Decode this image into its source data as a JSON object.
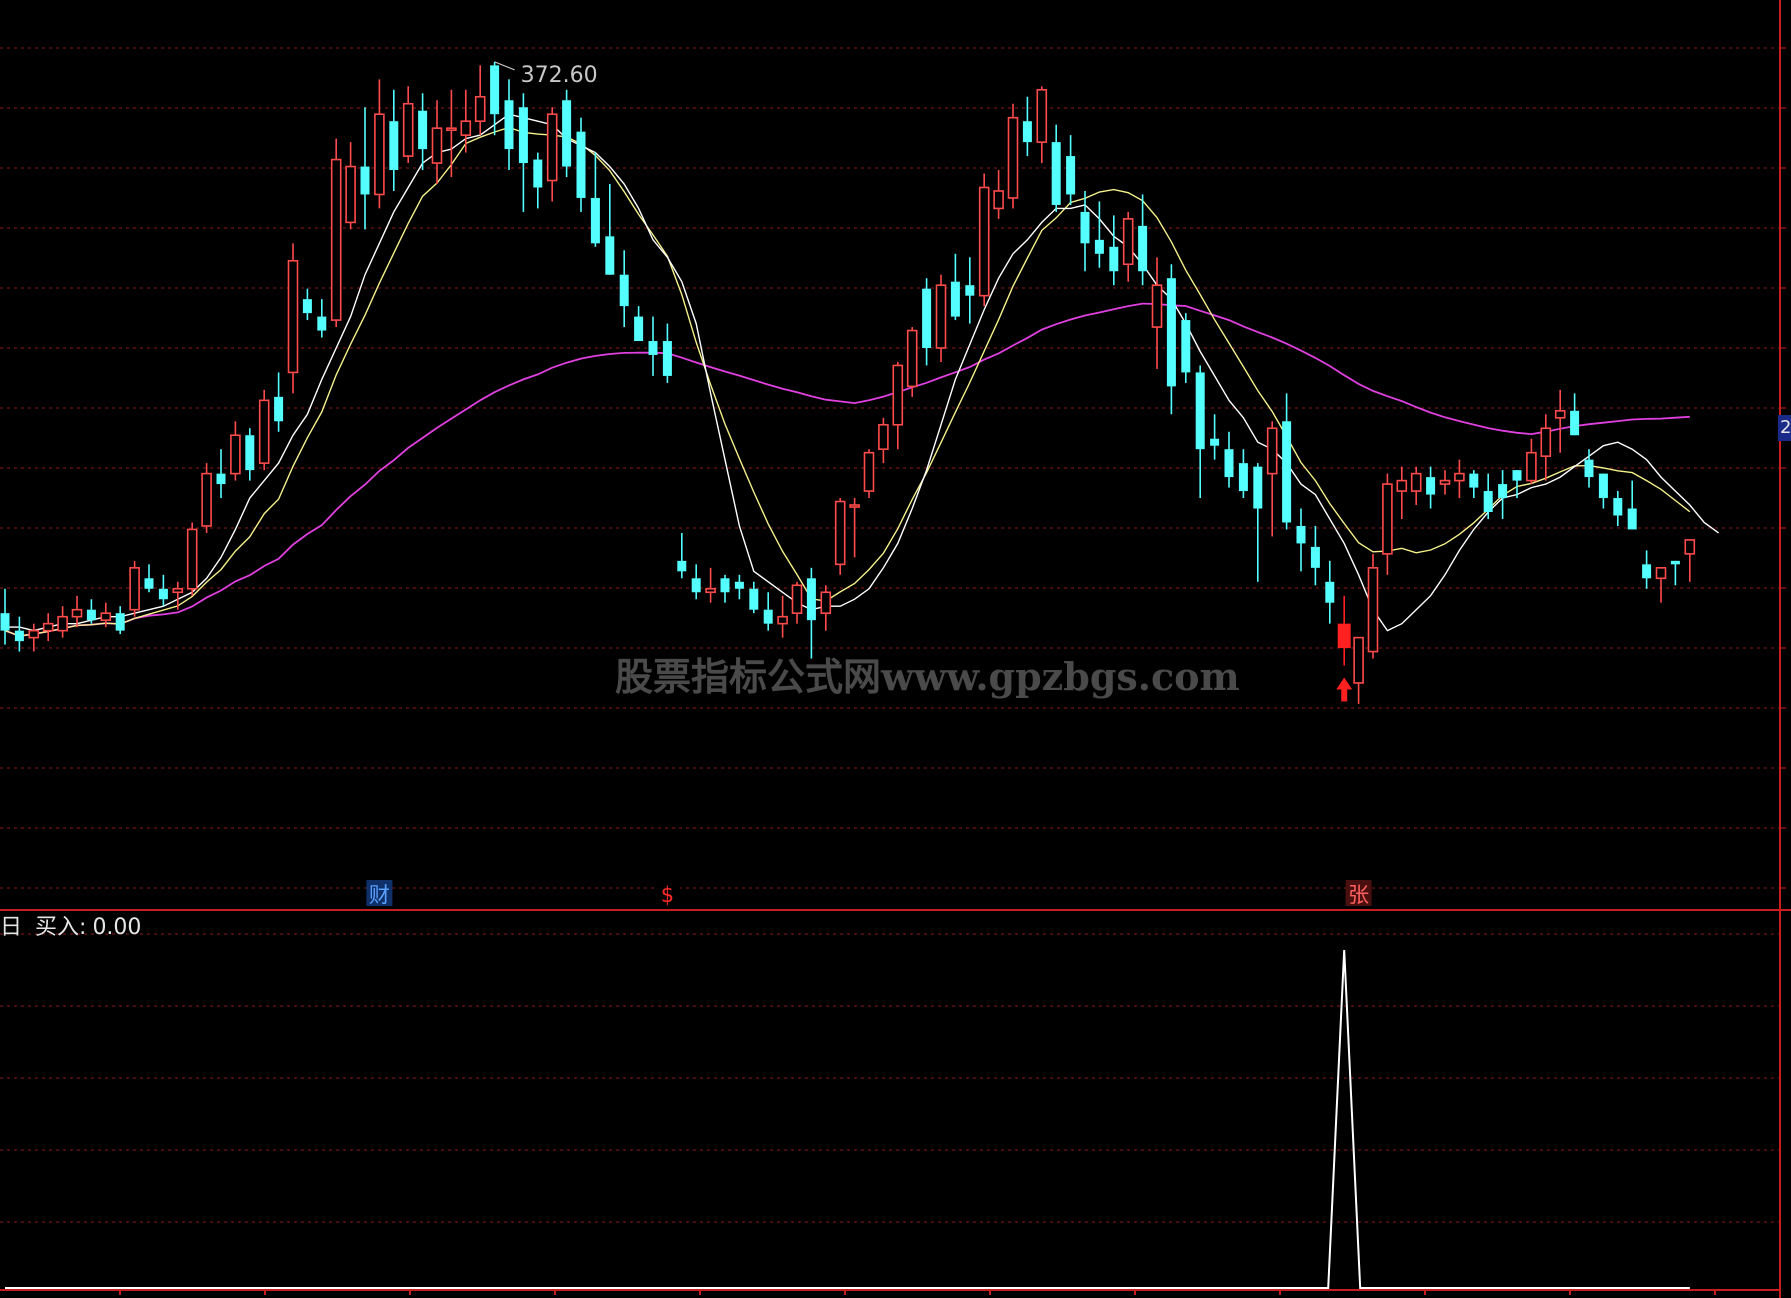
{
  "colors": {
    "background": "#000000",
    "grid": "#8a1a1a",
    "frame": "#c81e1e",
    "up_candle": "#ff4b4b",
    "down_candle": "#54ffff",
    "ma_fast": "#ffffff",
    "ma_mid": "#f5f08a",
    "ma_slow": "#e040e0",
    "signal_line": "#ffffff",
    "buy_candle": "#ff2020"
  },
  "top_legend_colors": [
    "#ff4b4b",
    "#54ff54",
    "#ff4b4b",
    "#ffff54",
    "#e6e6e6",
    "#ff4b4b",
    "#ff4bff",
    "#ffa050",
    "#e6e6e6",
    "#54ff54",
    "#ffa050"
  ],
  "price_peak_label": "372.60",
  "watermark": "股票指标公式网www.gpzbgs.com",
  "event_markers": [
    {
      "text": "财",
      "color": "#5aa0ff",
      "bg": "#10306a",
      "index": 26
    },
    {
      "text": "$",
      "color": "#ff2a2a",
      "bg": "#000000",
      "index": 46
    },
    {
      "text": "张",
      "color": "#ff6060",
      "bg": "#4a1010",
      "index": 94
    }
  ],
  "indicator": {
    "name": "日",
    "label": "买入:",
    "value": "0.00"
  },
  "right_axis_tag": "2",
  "chart_data": {
    "type": "candlestick",
    "ylim": [
      150,
      385
    ],
    "signal_index": 93,
    "candles": [
      [
        215,
        222,
        206,
        210
      ],
      [
        210,
        214,
        204,
        207
      ],
      [
        208,
        212,
        204,
        210
      ],
      [
        210,
        215,
        207,
        212
      ],
      [
        210,
        217,
        208,
        214
      ],
      [
        214,
        220,
        211,
        216
      ],
      [
        216,
        219,
        212,
        213
      ],
      [
        213,
        218,
        211,
        215
      ],
      [
        215,
        217,
        209,
        210
      ],
      [
        216,
        230,
        214,
        228
      ],
      [
        225,
        229,
        221,
        222
      ],
      [
        222,
        226,
        217,
        219
      ],
      [
        221,
        224,
        216,
        222
      ],
      [
        222,
        241,
        220,
        239
      ],
      [
        240,
        258,
        238,
        255
      ],
      [
        255,
        262,
        248,
        252
      ],
      [
        255,
        270,
        253,
        266
      ],
      [
        266,
        268,
        253,
        256
      ],
      [
        258,
        279,
        256,
        276
      ],
      [
        277,
        284,
        267,
        270
      ],
      [
        284,
        321,
        278,
        316
      ],
      [
        305,
        308,
        299,
        301
      ],
      [
        300,
        305,
        294,
        296
      ],
      [
        299,
        351,
        297,
        345
      ],
      [
        327,
        350,
        325,
        343
      ],
      [
        343,
        360,
        325,
        335
      ],
      [
        335,
        368,
        331,
        358
      ],
      [
        356,
        365,
        336,
        342
      ],
      [
        346,
        366,
        344,
        361
      ],
      [
        359,
        364,
        342,
        348
      ],
      [
        344,
        362,
        338,
        354
      ],
      [
        354,
        365,
        340,
        354
      ],
      [
        352,
        365,
        347,
        356
      ],
      [
        356,
        372,
        352,
        363
      ],
      [
        372,
        373,
        352,
        358
      ],
      [
        362,
        368,
        342,
        348
      ],
      [
        360,
        364,
        330,
        344
      ],
      [
        345,
        347,
        331,
        337
      ],
      [
        339,
        360,
        333,
        358
      ],
      [
        362,
        365,
        340,
        343
      ],
      [
        353,
        357,
        330,
        334
      ],
      [
        334,
        347,
        320,
        321
      ],
      [
        323,
        338,
        312,
        312
      ],
      [
        312,
        319,
        297,
        303
      ],
      [
        300,
        303,
        294,
        293
      ],
      [
        293,
        300,
        283,
        289
      ],
      [
        293,
        298,
        281,
        283
      ],
      [
        230,
        238,
        225,
        227
      ],
      [
        225,
        229,
        219,
        221
      ],
      [
        221,
        228,
        218,
        222
      ],
      [
        225,
        226,
        218,
        221
      ],
      [
        224,
        226,
        219,
        222
      ],
      [
        222,
        224,
        215,
        216
      ],
      [
        216,
        221,
        210,
        212
      ],
      [
        212,
        220,
        208,
        214
      ],
      [
        215,
        224,
        212,
        223
      ],
      [
        225,
        228,
        202,
        213
      ],
      [
        215,
        223,
        210,
        221
      ],
      [
        229,
        248,
        226,
        247
      ],
      [
        246,
        248,
        231,
        246
      ],
      [
        250,
        262,
        248,
        261
      ],
      [
        262,
        271,
        258,
        269
      ],
      [
        269,
        287,
        262,
        286
      ],
      [
        280,
        297,
        277,
        296
      ],
      [
        308,
        311,
        286,
        291
      ],
      [
        291,
        312,
        287,
        309
      ],
      [
        310,
        318,
        299,
        300
      ],
      [
        309,
        317,
        298,
        306
      ],
      [
        306,
        341,
        303,
        337
      ],
      [
        331,
        342,
        328,
        336
      ],
      [
        334,
        361,
        331,
        357
      ],
      [
        356,
        363,
        346,
        350
      ],
      [
        350,
        366,
        344,
        365
      ],
      [
        350,
        355,
        330,
        332
      ],
      [
        346,
        352,
        332,
        335
      ],
      [
        330,
        336,
        313,
        321
      ],
      [
        322,
        333,
        314,
        318
      ],
      [
        320,
        329,
        309,
        313
      ],
      [
        315,
        330,
        310,
        328
      ],
      [
        326,
        335,
        309,
        313
      ],
      [
        297,
        317,
        285,
        309
      ],
      [
        311,
        315,
        272,
        280
      ],
      [
        299,
        301,
        281,
        284
      ],
      [
        284,
        286,
        248,
        262
      ],
      [
        265,
        272,
        259,
        263
      ],
      [
        262,
        267,
        251,
        254
      ],
      [
        258,
        262,
        248,
        250
      ],
      [
        257,
        258,
        224,
        245
      ],
      [
        255,
        270,
        237,
        268
      ],
      [
        270,
        278,
        239,
        241
      ],
      [
        240,
        245,
        227,
        235
      ],
      [
        234,
        240,
        223,
        228
      ],
      [
        224,
        230,
        212,
        218
      ],
      [
        212,
        220,
        200,
        205
      ],
      [
        195,
        206,
        189,
        208
      ],
      [
        204,
        232,
        202,
        228
      ],
      [
        232,
        255,
        226,
        252
      ],
      [
        250,
        257,
        242,
        253
      ],
      [
        250,
        257,
        246,
        255
      ],
      [
        254,
        257,
        245,
        249
      ],
      [
        252,
        256,
        249,
        253
      ],
      [
        253,
        259,
        248,
        255
      ],
      [
        255,
        256,
        248,
        251
      ],
      [
        250,
        255,
        242,
        244
      ],
      [
        252,
        256,
        242,
        248
      ],
      [
        256,
        256,
        248,
        253
      ],
      [
        253,
        265,
        252,
        261
      ],
      [
        260,
        272,
        253,
        268
      ],
      [
        271,
        279,
        261,
        273
      ],
      [
        273,
        278,
        266,
        266
      ],
      [
        259,
        262,
        251,
        254
      ],
      [
        255,
        255,
        245,
        248
      ],
      [
        248,
        250,
        240,
        243
      ],
      [
        245,
        253,
        239,
        239
      ],
      [
        229,
        233,
        222,
        225
      ],
      [
        225,
        228,
        218,
        228
      ],
      [
        230,
        230,
        223,
        229
      ],
      [
        232,
        234,
        224,
        236
      ]
    ],
    "ma_fast": [
      211,
      211,
      210,
      211,
      212,
      212,
      213,
      214,
      214,
      215,
      216,
      217,
      219,
      221,
      225,
      231,
      239,
      248,
      253,
      258,
      266,
      272,
      282,
      291,
      300,
      312,
      321,
      330,
      337,
      344,
      347,
      348,
      351,
      352,
      355,
      358,
      357,
      356,
      355,
      351,
      349,
      347,
      343,
      338,
      331,
      322,
      317,
      310,
      298,
      278,
      259,
      240,
      227,
      224,
      221,
      218,
      216,
      217,
      217,
      219,
      222,
      228,
      235,
      245,
      256,
      269,
      282,
      292,
      302,
      311,
      318,
      322,
      327,
      331,
      331,
      332,
      328,
      323,
      320,
      315,
      309,
      305,
      298,
      290,
      283,
      276,
      271,
      264,
      262,
      258,
      252,
      249,
      242,
      235,
      226,
      216,
      210,
      212,
      216,
      220,
      226,
      233,
      239,
      244,
      248,
      249,
      251,
      252,
      254,
      257,
      260,
      263,
      264,
      262,
      259,
      254,
      250,
      246,
      241,
      238
    ]
  }
}
